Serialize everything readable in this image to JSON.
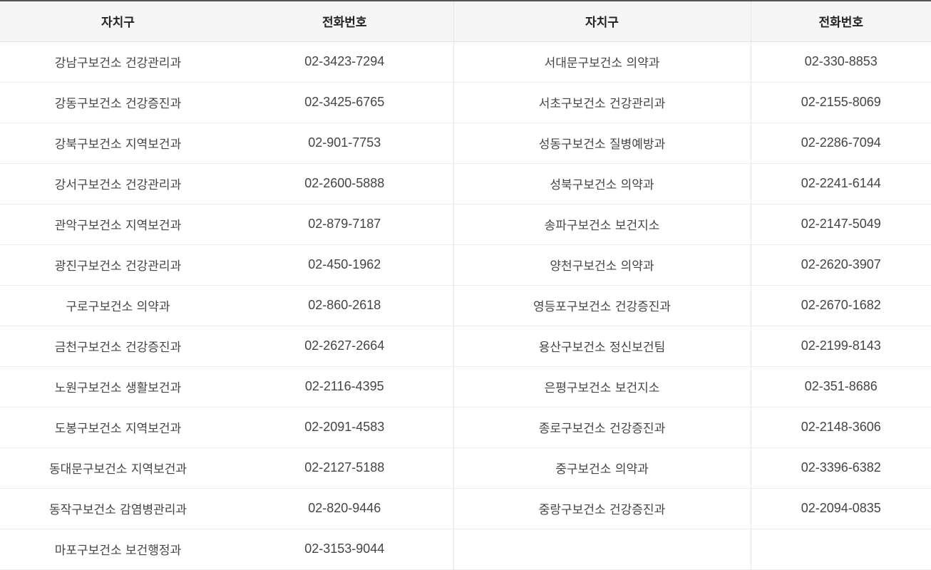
{
  "headers": [
    "자치구",
    "전화번호",
    "자치구",
    "전화번호"
  ],
  "rows": [
    [
      "강남구보건소 건강관리과",
      "02-3423-7294",
      "서대문구보건소 의약과",
      "02-330-8853"
    ],
    [
      "강동구보건소 건강증진과",
      "02-3425-6765",
      "서초구보건소 건강관리과",
      "02-2155-8069"
    ],
    [
      "강북구보건소 지역보건과",
      "02-901-7753",
      "성동구보건소 질병예방과",
      "02-2286-7094"
    ],
    [
      "강서구보건소 건강관리과",
      "02-2600-5888",
      "성북구보건소 의약과",
      "02-2241-6144"
    ],
    [
      "관악구보건소 지역보건과",
      "02-879-7187",
      "송파구보건소 보건지소",
      "02-2147-5049"
    ],
    [
      "광진구보건소 건강관리과",
      "02-450-1962",
      "양천구보건소 의약과",
      "02-2620-3907"
    ],
    [
      "구로구보건소 의약과",
      "02-860-2618",
      "영등포구보건소 건강증진과",
      "02-2670-1682"
    ],
    [
      "금천구보건소 건강증진과",
      "02-2627-2664",
      "용산구보건소 정신보건팀",
      "02-2199-8143"
    ],
    [
      "노원구보건소 생활보건과",
      "02-2116-4395",
      "은평구보건소 보건지소",
      "02-351-8686"
    ],
    [
      "도봉구보건소 지역보건과",
      "02-2091-4583",
      "종로구보건소 건강증진과",
      "02-2148-3606"
    ],
    [
      "동대문구보건소 지역보건과",
      "02-2127-5188",
      "중구보건소 의약과",
      "02-3396-6382"
    ],
    [
      "동작구보건소 감염병관리과",
      "02-820-9446",
      "중랑구보건소 건강증진과",
      "02-2094-0835"
    ],
    [
      "마포구보건소 보건행정과",
      "02-3153-9044",
      "",
      ""
    ]
  ]
}
